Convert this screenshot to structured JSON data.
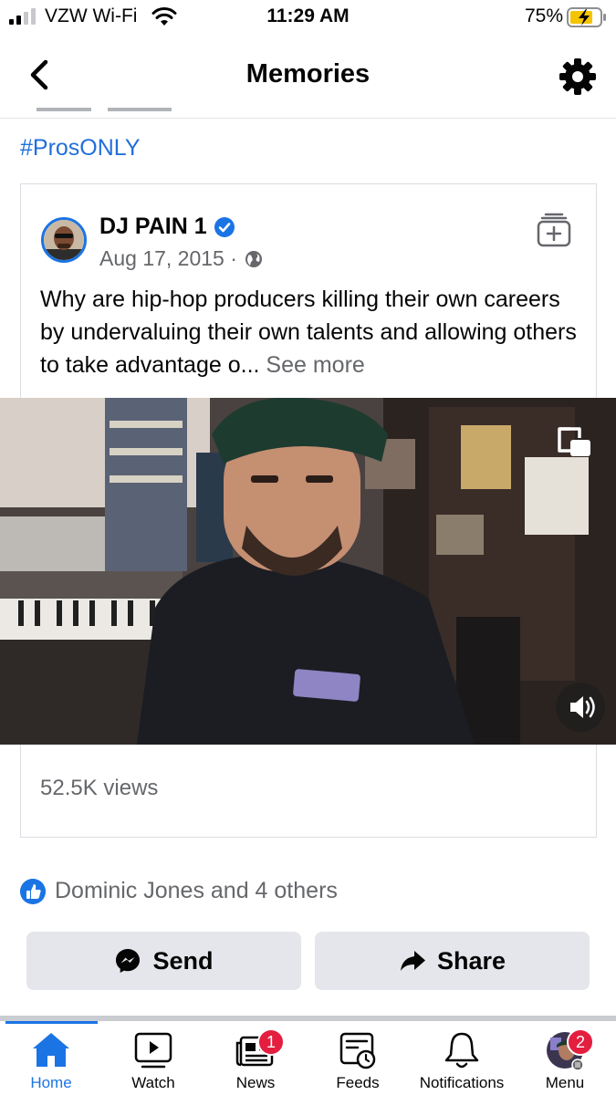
{
  "status_bar": {
    "carrier": "VZW Wi-Fi",
    "time": "11:29 AM",
    "battery_percent": "75%"
  },
  "header": {
    "title": "Memories"
  },
  "hashtag": "#ProsONLY",
  "post": {
    "author": "DJ PAIN 1",
    "date": "Aug 17, 2015 ·",
    "text": "Why are hip-hop producers killing their own careers by undervaluing their own talents and allowing others to take advantage o...",
    "see_more": "See more",
    "views": "52.5K views"
  },
  "reactions": {
    "text": "Dominic Jones and 4 others"
  },
  "actions": {
    "send_label": "Send",
    "share_label": "Share"
  },
  "tab_bar": {
    "tabs": [
      {
        "label": "Home"
      },
      {
        "label": "Watch"
      },
      {
        "label": "News",
        "badge": "1"
      },
      {
        "label": "Feeds"
      },
      {
        "label": "Notifications"
      },
      {
        "label": "Menu",
        "badge": "2"
      }
    ]
  },
  "colors": {
    "accent": "#1b74e4",
    "hashtag": "#216fdb",
    "badge": "#e41e3f",
    "secondary_text": "#65676b",
    "button_bg": "#e4e6eb"
  }
}
